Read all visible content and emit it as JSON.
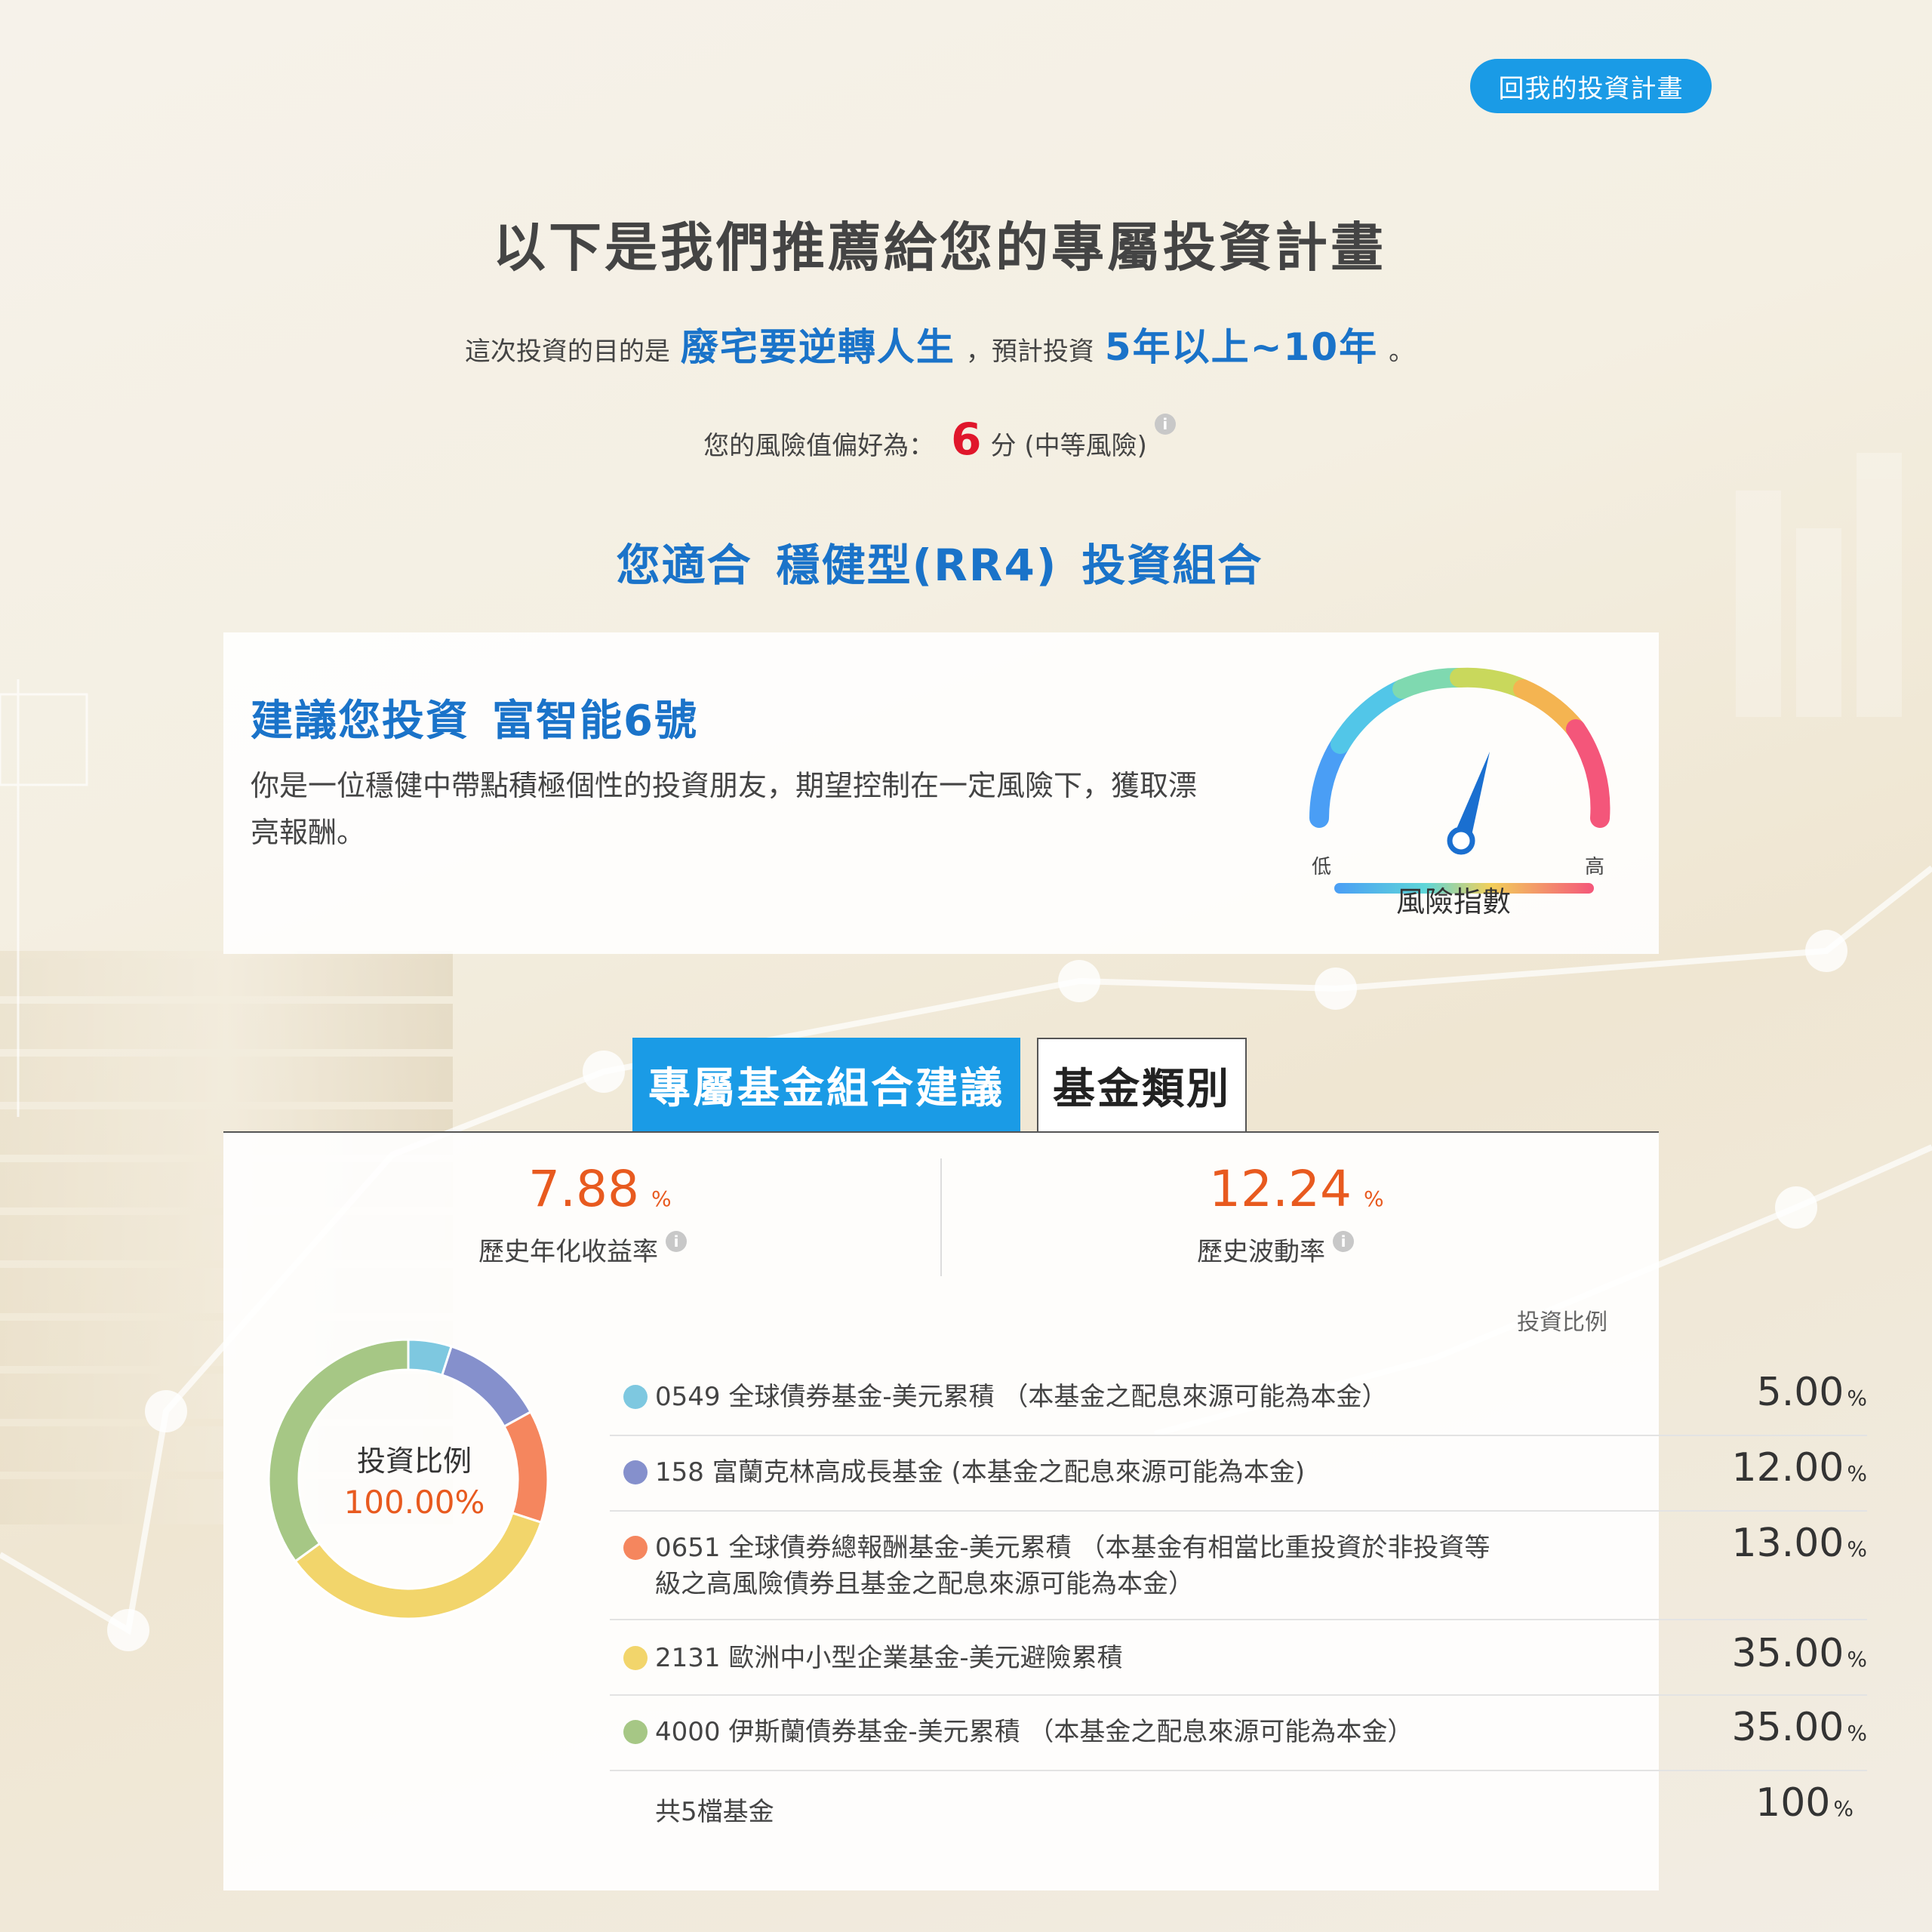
{
  "header": {
    "back_label": "回我的投資計畫"
  },
  "title": "以下是我們推薦給您的專屬投資計畫",
  "purpose": {
    "prefix": "這次投資的目的是",
    "goal": "廢宅要逆轉人生",
    "mid": "，預計投資",
    "period": "5年以上~10年",
    "suffix": "。"
  },
  "risk": {
    "prefix": "您的風險值偏好為：",
    "score": "6",
    "unit": "分",
    "level": "(中等風險)"
  },
  "suitability": {
    "prefix": "您適合",
    "type": "穩健型(RR4)",
    "suffix": "投資組合"
  },
  "recommendation": {
    "prefix": "建議您投資",
    "product": "富智能6號",
    "description": "你是一位穩健中帶點積極個性的投資朋友，期望控制在一定風險下，獲取漂亮報酬。"
  },
  "gauge": {
    "low": "低",
    "high": "高",
    "label": "風險指數",
    "level": 0.6
  },
  "tabs": {
    "active": "專屬基金組合建議",
    "inactive": "基金類別"
  },
  "stats": {
    "return_value": "7.88",
    "return_unit": "%",
    "return_label": "歷史年化收益率",
    "volatility_value": "12.24",
    "volatility_unit": "%",
    "volatility_label": "歷史波動率"
  },
  "allocation": {
    "column_header": "投資比例",
    "center_label": "投資比例",
    "center_value": "100.00%",
    "funds": [
      {
        "name": "0549 全球債券基金-美元累積 （本基金之配息來源可能為本金）",
        "value": "5.00",
        "unit": "%",
        "color": "#7ec8e0",
        "share": 5
      },
      {
        "name": "158 富蘭克林高成長基金 (本基金之配息來源可能為本金)",
        "value": "12.00",
        "unit": "%",
        "color": "#8590cc",
        "share": 12
      },
      {
        "name": "0651 全球債券總報酬基金-美元累積 （本基金有相當比重投資於非投資等級之高風險債券且基金之配息來源可能為本金）",
        "value": "13.00",
        "unit": "%",
        "color": "#f5865e",
        "share": 13
      },
      {
        "name": "2131 歐洲中小型企業基金-美元避險累積",
        "value": "35.00",
        "unit": "%",
        "color": "#f2d56b",
        "share": 35
      },
      {
        "name": "4000 伊斯蘭債券基金-美元累積 （本基金之配息來源可能為本金）",
        "value": "35.00",
        "unit": "%",
        "color": "#a6c785",
        "share": 35
      }
    ],
    "total_label": "共5檔基金",
    "total_value": "100",
    "total_unit": "%"
  }
}
